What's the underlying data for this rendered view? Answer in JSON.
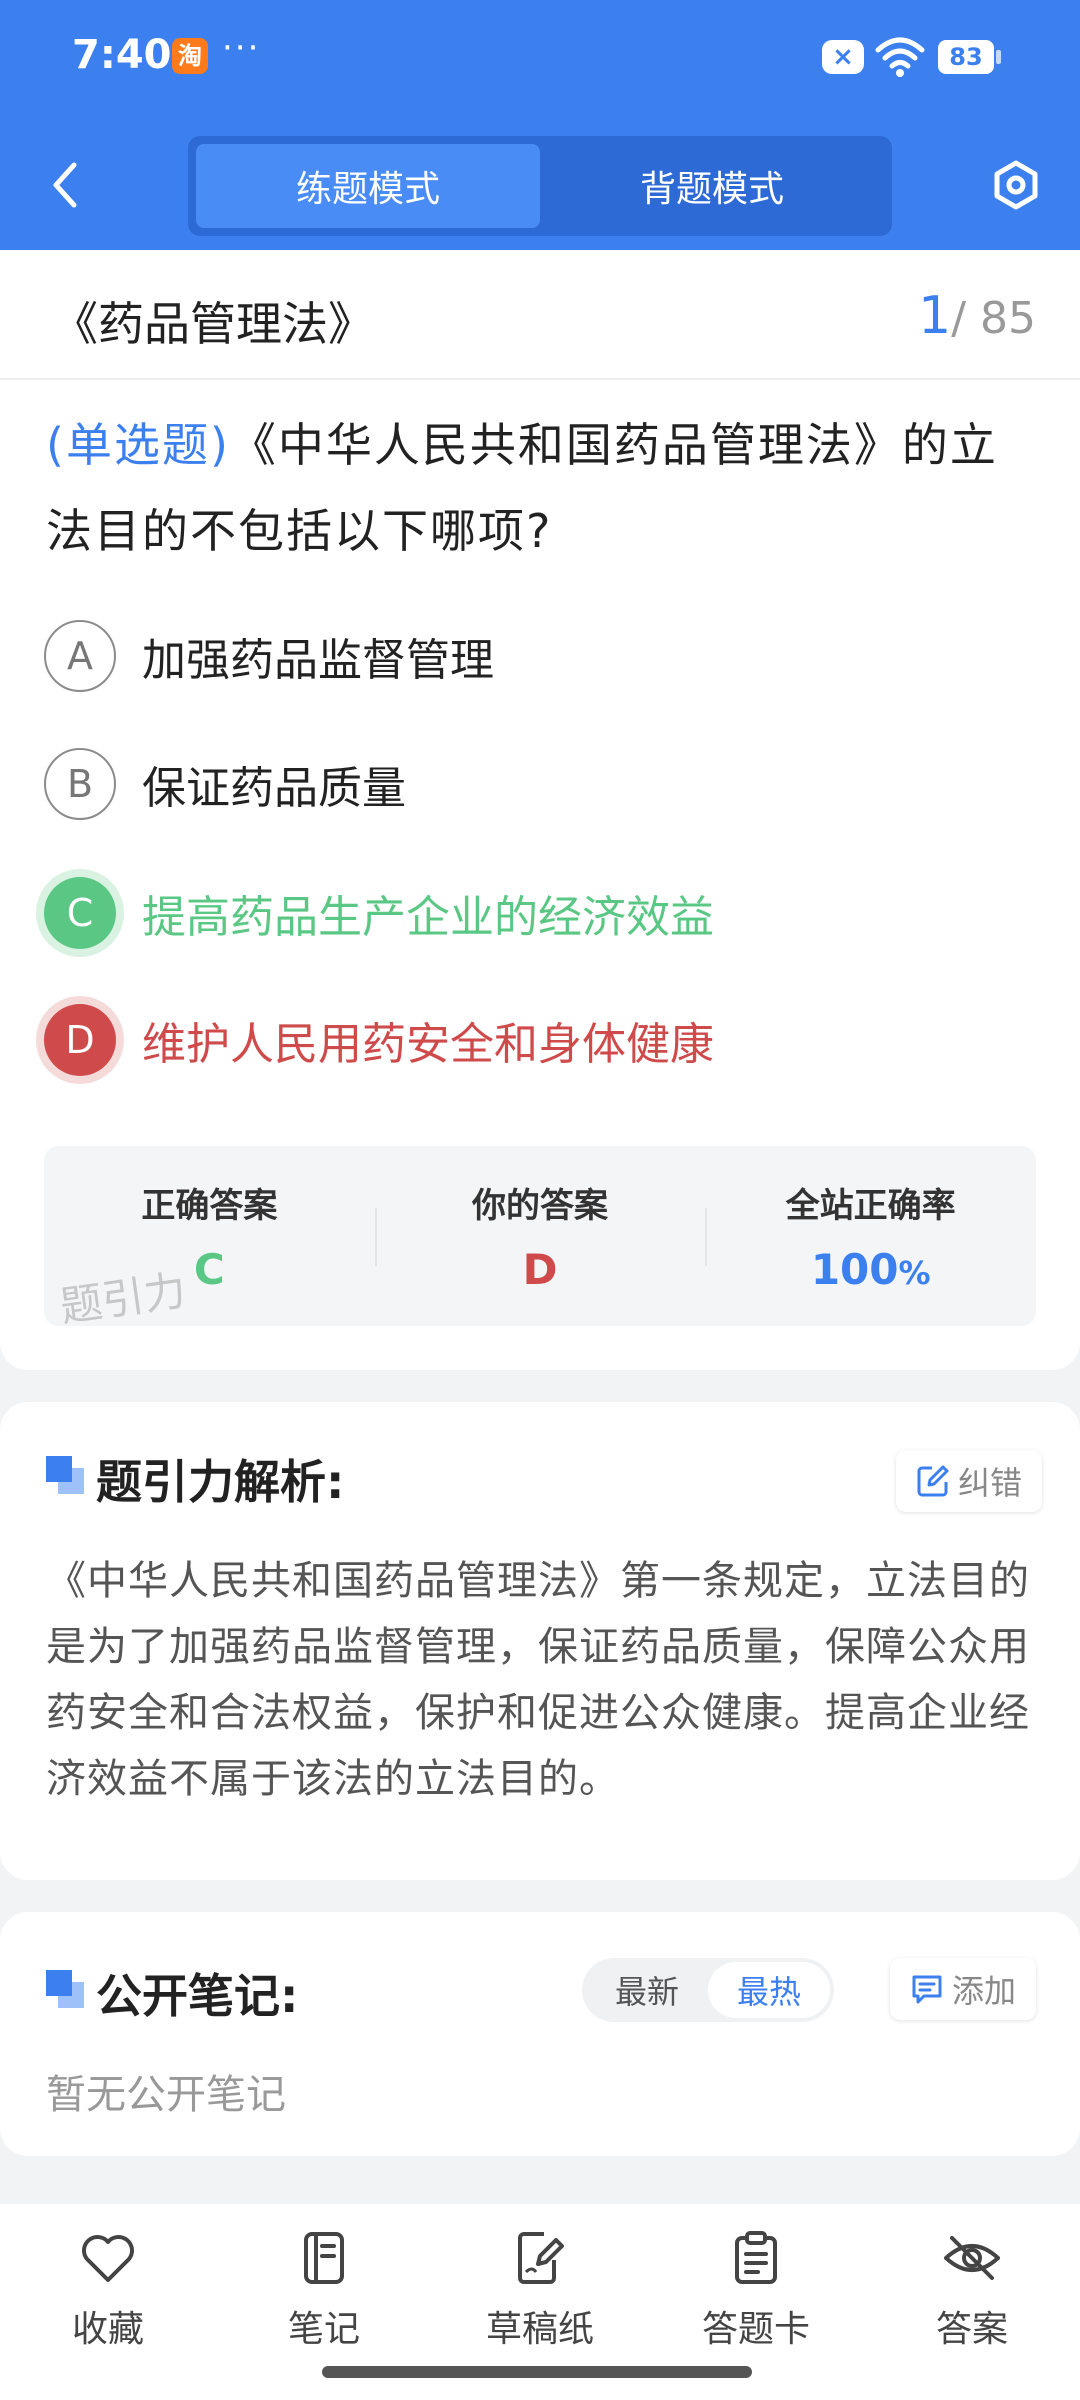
{
  "status_bar": {
    "time": "7:40",
    "app_badge": "淘",
    "more": "···",
    "x_badge": "×",
    "battery": "83"
  },
  "header": {
    "tabs": [
      {
        "label": "练题模式",
        "active": true
      },
      {
        "label": "背题模式",
        "active": false
      }
    ],
    "accent_color": "#3c80ef"
  },
  "chapter": {
    "title": "《药品管理法》",
    "current": "1",
    "total": "/ 85"
  },
  "question": {
    "type_label": "(单选题)",
    "text": "《中华人民共和国药品管理法》的立法目的不包括以下哪项?",
    "options": [
      {
        "letter": "A",
        "text": "加强药品监督管理",
        "state": "normal"
      },
      {
        "letter": "B",
        "text": "保证药品质量",
        "state": "normal"
      },
      {
        "letter": "C",
        "text": "提高药品生产企业的经济效益",
        "state": "correct"
      },
      {
        "letter": "D",
        "text": "维护人民用药安全和身体健康",
        "state": "wrong"
      }
    ]
  },
  "stats": {
    "correct_label": "正确答案",
    "correct_value": "C",
    "yours_label": "你的答案",
    "yours_value": "D",
    "rate_label": "全站正确率",
    "rate_value": "100",
    "rate_unit": "%",
    "watermark": "题引力"
  },
  "analysis": {
    "title": "题引力解析:",
    "correct_btn": "纠错",
    "text": "《中华人民共和国药品管理法》第一条规定，立法目的是为了加强药品监督管理，保证药品质量，保障公众用药安全和合法权益，保护和促进公众健康。提高企业经济效益不属于该法的立法目的。"
  },
  "notes": {
    "title": "公开笔记:",
    "sort_options": [
      {
        "label": "最新",
        "active": false
      },
      {
        "label": "最热",
        "active": true
      }
    ],
    "add_btn": "添加",
    "empty_text": "暂无公开笔记"
  },
  "bottom_nav": [
    {
      "label": "收藏",
      "icon": "heart-icon"
    },
    {
      "label": "笔记",
      "icon": "notebook-icon"
    },
    {
      "label": "草稿纸",
      "icon": "draft-paper-icon"
    },
    {
      "label": "答题卡",
      "icon": "answer-card-icon"
    },
    {
      "label": "答案",
      "icon": "eye-off-icon"
    }
  ],
  "colors": {
    "correct": "#5ac884",
    "wrong": "#cf4a4a",
    "accent": "#3c80ef"
  }
}
